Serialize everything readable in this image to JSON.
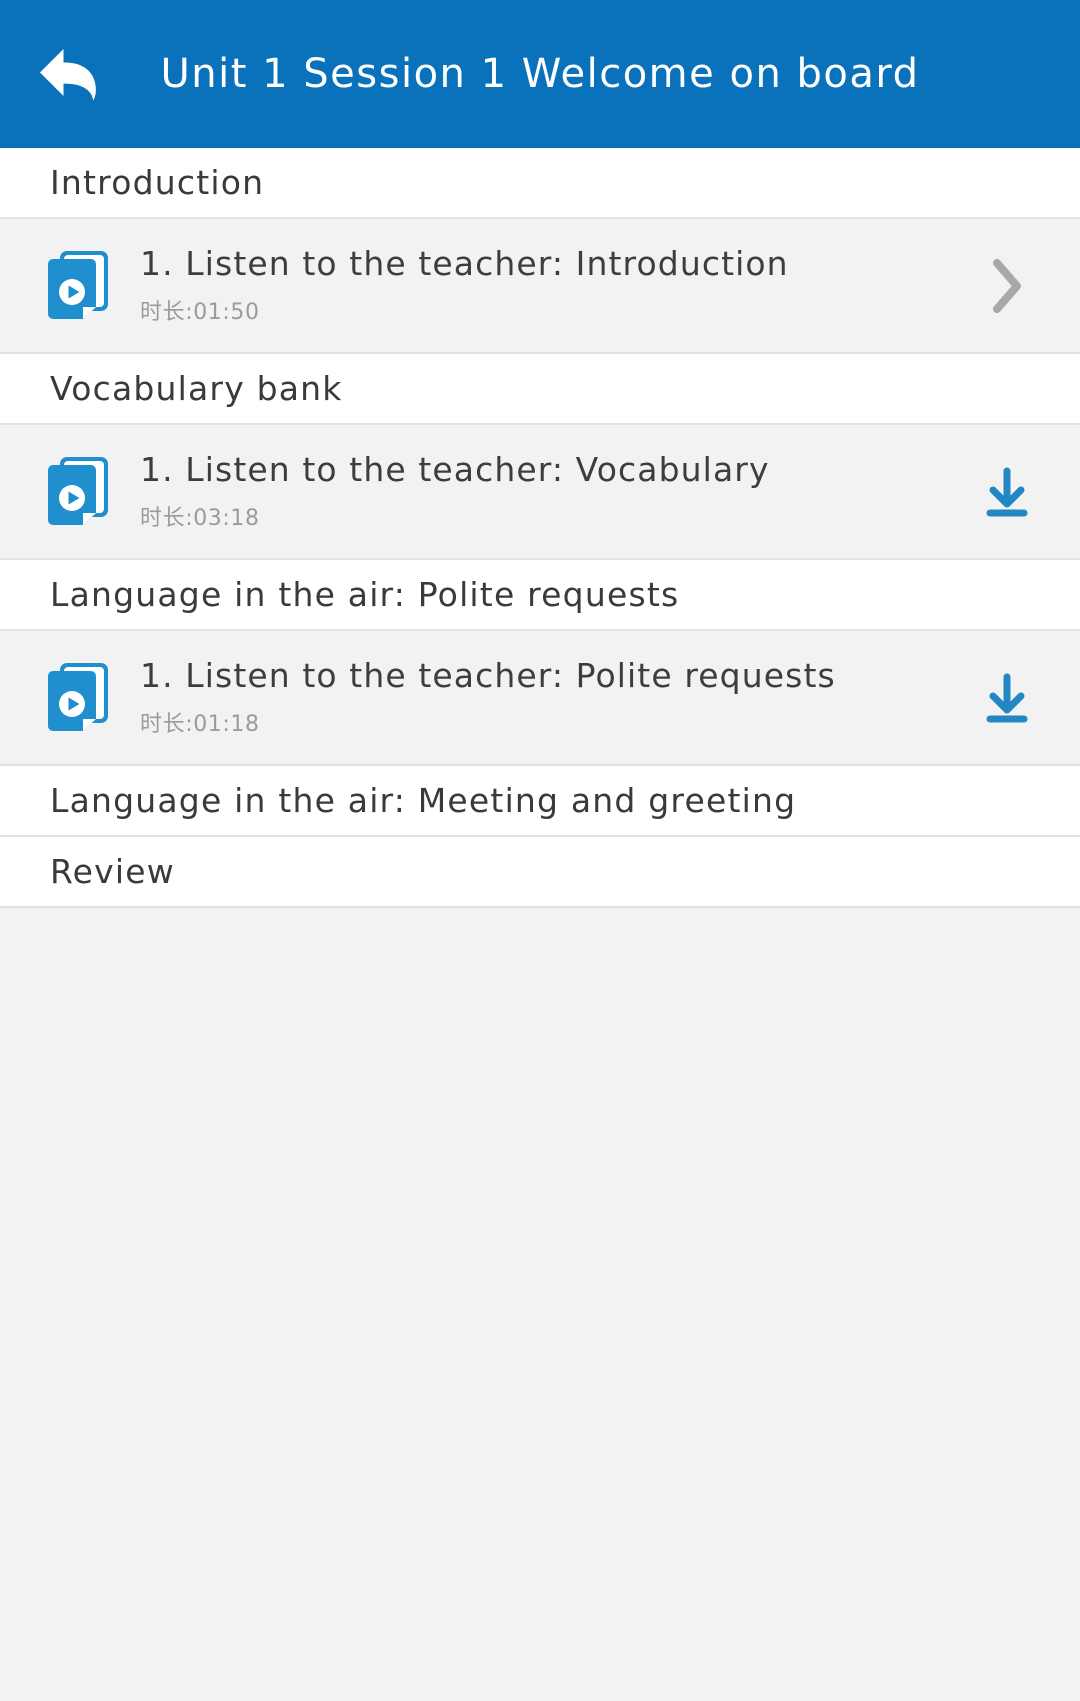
{
  "header": {
    "title": "Unit 1 Session 1 Welcome on board",
    "back_icon": "back-arrow-icon",
    "background_color": "#0a72ba",
    "text_color": "#ffffff"
  },
  "colors": {
    "accent_blue": "#0a72ba",
    "icon_blue": "#1f8fcd",
    "row_background": "#f2f2f2",
    "section_background": "#ffffff",
    "divider": "#e2e2e2",
    "title_text": "#3d3d3d",
    "duration_text": "#9b9b9b",
    "chevron_gray": "#a8a8a8"
  },
  "list": [
    {
      "type": "section",
      "label": "Introduction"
    },
    {
      "type": "lesson",
      "title": "1. Listen to the teacher: Introduction",
      "duration": "时长:01:50",
      "media_icon": "audio-card-play-icon",
      "action": "chevron-right-icon"
    },
    {
      "type": "section",
      "label": "Vocabulary bank"
    },
    {
      "type": "lesson",
      "title": "1. Listen to the teacher: Vocabulary",
      "duration": "时长:03:18",
      "media_icon": "audio-card-play-icon",
      "action": "download-icon"
    },
    {
      "type": "section",
      "label": "Language in the air: Polite requests"
    },
    {
      "type": "lesson",
      "title": "1. Listen to the teacher: Polite requests",
      "duration": "时长:01:18",
      "media_icon": "audio-card-play-icon",
      "action": "download-icon"
    },
    {
      "type": "section",
      "label": "Language in the air: Meeting and greeting"
    },
    {
      "type": "section",
      "label": "Review"
    }
  ]
}
